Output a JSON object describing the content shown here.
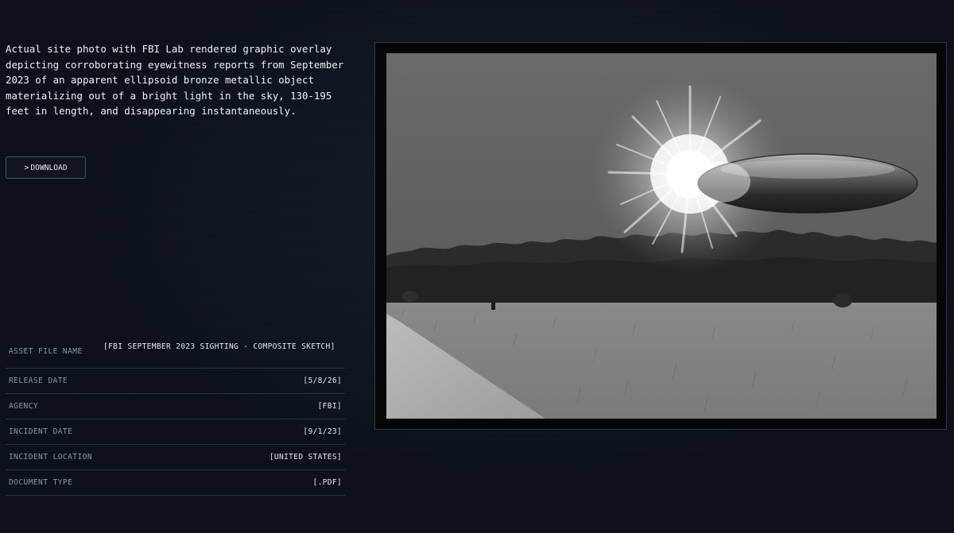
{
  "description": "Actual site photo with FBI Lab rendered graphic overlay depicting corroborating eyewitness reports from September 2023 of an apparent ellipsoid bronze metallic object materializing out of a bright light in the sky, 130-195 feet in length, and disappearing instantaneously.",
  "download": {
    "prefix": ">",
    "label": "DOWNLOAD"
  },
  "metadata": {
    "asset_file_name": {
      "label": "ASSET FILE NAME",
      "value": "[FBI SEPTEMBER 2023 SIGHTING - COMPOSITE SKETCH]"
    },
    "release_date": {
      "label": "RELEASE DATE",
      "value": "[5/8/26]"
    },
    "agency": {
      "label": "AGENCY",
      "value": "[FBI]"
    },
    "incident_date": {
      "label": "INCIDENT DATE",
      "value": "[9/1/23]"
    },
    "incident_location": {
      "label": "INCIDENT LOCATION",
      "value": "[UNITED STATES]"
    },
    "document_type": {
      "label": "DOCUMENT TYPE",
      "value": "[.PDF]"
    }
  },
  "colors": {
    "background": "#0b1018",
    "text": "#eef1f5",
    "muted_label": "#8d96a3",
    "divider": "#2a3341"
  }
}
